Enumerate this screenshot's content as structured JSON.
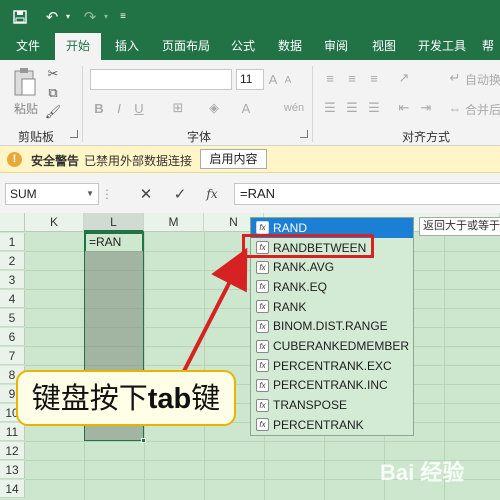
{
  "quick_access": {
    "save_icon": "save-icon",
    "undo_icon": "undo-icon",
    "redo_icon": "redo-icon",
    "customize_icon": "customize-icon"
  },
  "ribbon_tabs": [
    "文件",
    "开始",
    "插入",
    "页面布局",
    "公式",
    "数据",
    "审阅",
    "视图",
    "开发工具",
    "帮"
  ],
  "ribbon": {
    "paste_label": "粘贴",
    "clipboard_group": "剪贴板",
    "font_group": "字体",
    "font_size": "11",
    "align_group": "对齐方式",
    "wrap_label": "自动换",
    "merge_label": "合并后"
  },
  "security_bar": {
    "title": "安全警告",
    "message": "已禁用外部数据连接",
    "button": "启用内容"
  },
  "formula_bar": {
    "name_box": "SUM",
    "cancel": "✕",
    "enter": "✓",
    "fx": "fx",
    "formula": "=RAN"
  },
  "columns": [
    "K",
    "L",
    "M",
    "N"
  ],
  "rows": [
    "1",
    "2",
    "3",
    "4",
    "5",
    "6",
    "7",
    "8",
    "9",
    "10",
    "11",
    "12",
    "13",
    "14"
  ],
  "active_cell_text": "=RAN",
  "autocomplete": {
    "items": [
      "RAND",
      "RANDBETWEEN",
      "RANK.AVG",
      "RANK.EQ",
      "RANK",
      "BINOM.DIST.RANGE",
      "CUBERANKEDMEMBER",
      "PERCENTRANK.EXC",
      "PERCENTRANK.INC",
      "TRANSPOSE",
      "PERCENTRANK"
    ],
    "highlighted": "RANDBETWEEN",
    "tooltip": "返回大于或等于"
  },
  "callout": {
    "prefix": "键盘按下",
    "key": "tab",
    "suffix": "键"
  },
  "watermark": "Bai 经验",
  "colors": {
    "excel_green": "#217346",
    "highlight_red": "#d62222",
    "callout_border": "#e8b400"
  }
}
